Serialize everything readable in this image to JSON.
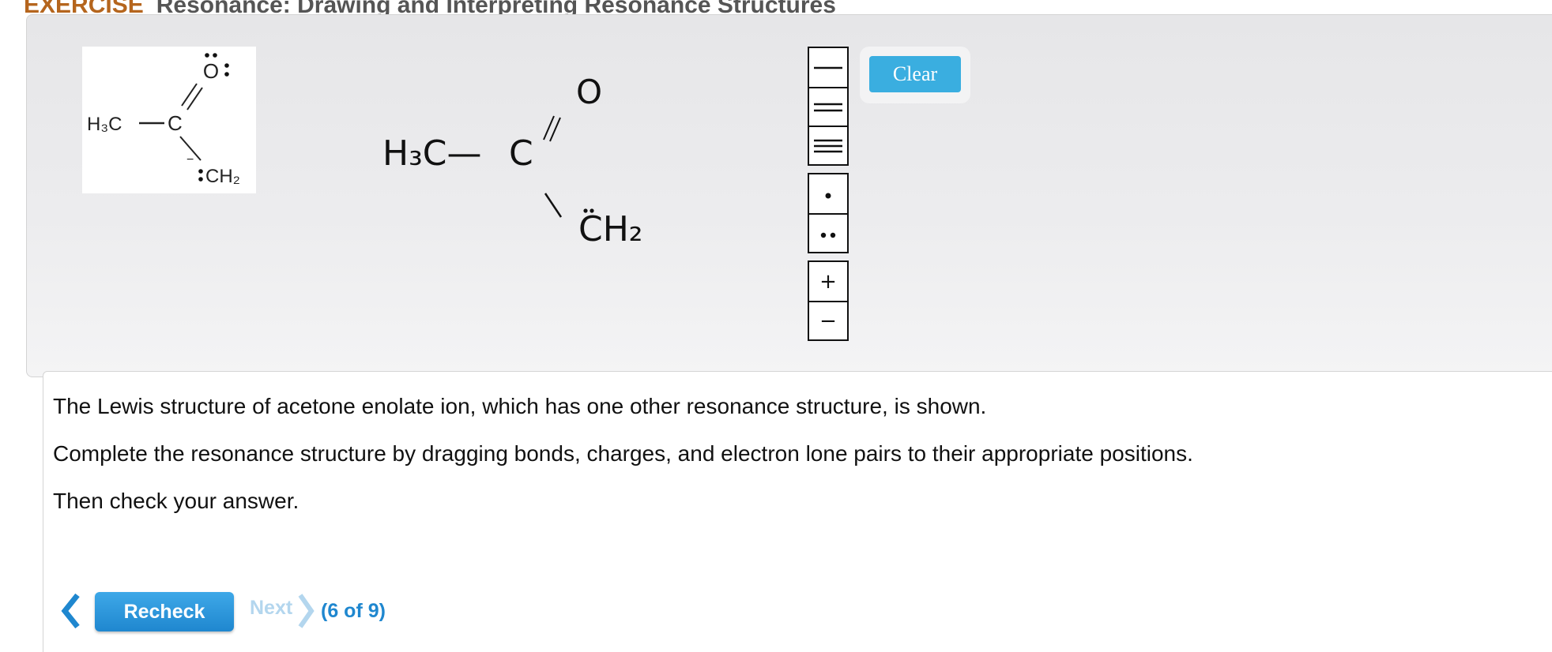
{
  "header": {
    "exercise_label": "EXERCISE",
    "title": "Resonance: Drawing and Interpreting Resonance Structures"
  },
  "reference_structure": {
    "methyl": "H₃C",
    "carbon": "C",
    "oxygen": "O",
    "methylene": "CH₂",
    "charge": "−"
  },
  "answer_structure": {
    "methyl": "H₃C—",
    "carbon": "C",
    "oxygen": "O",
    "methylene": "CH₂"
  },
  "palette": {
    "bonds": [
      "single-bond-icon",
      "double-bond-icon",
      "triple-bond-icon"
    ],
    "electrons": [
      "single-electron-icon",
      "lone-pair-icon"
    ],
    "charges": [
      "+",
      "−"
    ]
  },
  "clear_button": "Clear",
  "instructions": [
    "The Lewis structure of acetone enolate ion, which has one other resonance structure, is shown.",
    "Complete the resonance structure by dragging bonds, charges, and electron lone pairs to their appropriate positions.",
    "Then check your answer."
  ],
  "navigation": {
    "recheck": "Recheck",
    "next": "Next",
    "counter": "(6 of 9)"
  }
}
